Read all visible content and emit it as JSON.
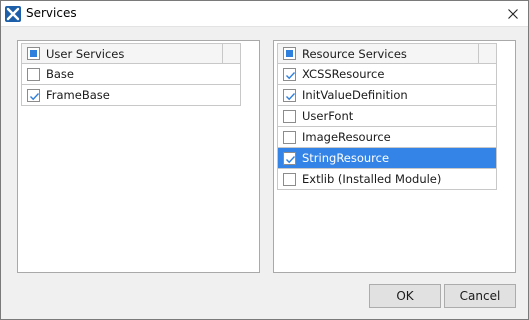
{
  "window": {
    "title": "Services"
  },
  "user_services": {
    "header": "User Services",
    "items": [
      {
        "label": "Base",
        "checked": false
      },
      {
        "label": "FrameBase",
        "checked": true
      }
    ]
  },
  "resource_services": {
    "header": "Resource Services",
    "items": [
      {
        "label": "XCSSResource",
        "checked": true,
        "selected": false
      },
      {
        "label": "InitValueDefinition",
        "checked": true,
        "selected": false
      },
      {
        "label": "UserFont",
        "checked": false,
        "selected": false
      },
      {
        "label": "ImageResource",
        "checked": false,
        "selected": false
      },
      {
        "label": "StringResource",
        "checked": true,
        "selected": true
      },
      {
        "label": "Extlib (Installed Module)",
        "checked": false,
        "selected": false
      }
    ]
  },
  "buttons": {
    "ok": "OK",
    "cancel": "Cancel"
  },
  "colors": {
    "selection": "#3384e6",
    "check_accent": "#2f7fdc"
  }
}
